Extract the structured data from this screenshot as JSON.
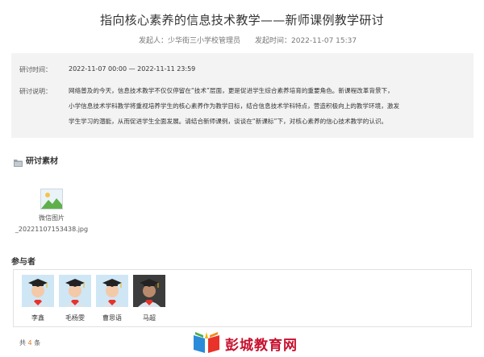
{
  "header": {
    "title": "指向核心素养的信息技术教学——新师课例教学研讨",
    "initiator_label": "发起人：少华街三小学校管理员",
    "initiated_time_label": "发起时间：2022-11-07 15:37"
  },
  "info": {
    "time_label": "研讨时间：",
    "time_value": "2022-11-07 00:00 — 2022-11-11 23:59",
    "desc_label": "研讨说明：",
    "desc_lines": [
      "网络普及的今天，信息技术教学不仅仅停留在“技术”层面，更是促进学生综合素养培育的重要角色。新课程改革背景下，",
      "小学信息技术学科教学将重视培养学生的核心素养作为教学目标，结合信息技术学科特点，营造积极向上的教学环境，激发",
      "学生学习的潜能，从而促进学生全面发展。请结合新师课例，谈谈在“新课标”下，对核心素养的信心技术教学的认识。"
    ]
  },
  "materials": {
    "section_title": "研讨素材",
    "file": {
      "name_line1": "微信图片",
      "name_line2": "_20221107153438.jpg"
    }
  },
  "participants": {
    "section_title": "参与者",
    "people": [
      {
        "name": "李鑫",
        "skin": "#f3c9a8",
        "bg": "#cfe6f5"
      },
      {
        "name": "毛杨雯",
        "skin": "#f3c9a8",
        "bg": "#cfe6f5"
      },
      {
        "name": "曹思语",
        "skin": "#f3c9a8",
        "bg": "#cfe6f5"
      },
      {
        "name": "马超",
        "skin": "#b98a6c",
        "bg": "#3c3c3c"
      }
    ],
    "total_prefix": "共",
    "total_count": "4",
    "total_suffix": "条"
  },
  "watermark": {
    "text": "彭城教育网"
  },
  "colors": {
    "accent_orange": "#e07a1f",
    "watermark_red": "#c8102e",
    "info_bg": "#f3f3f3"
  }
}
